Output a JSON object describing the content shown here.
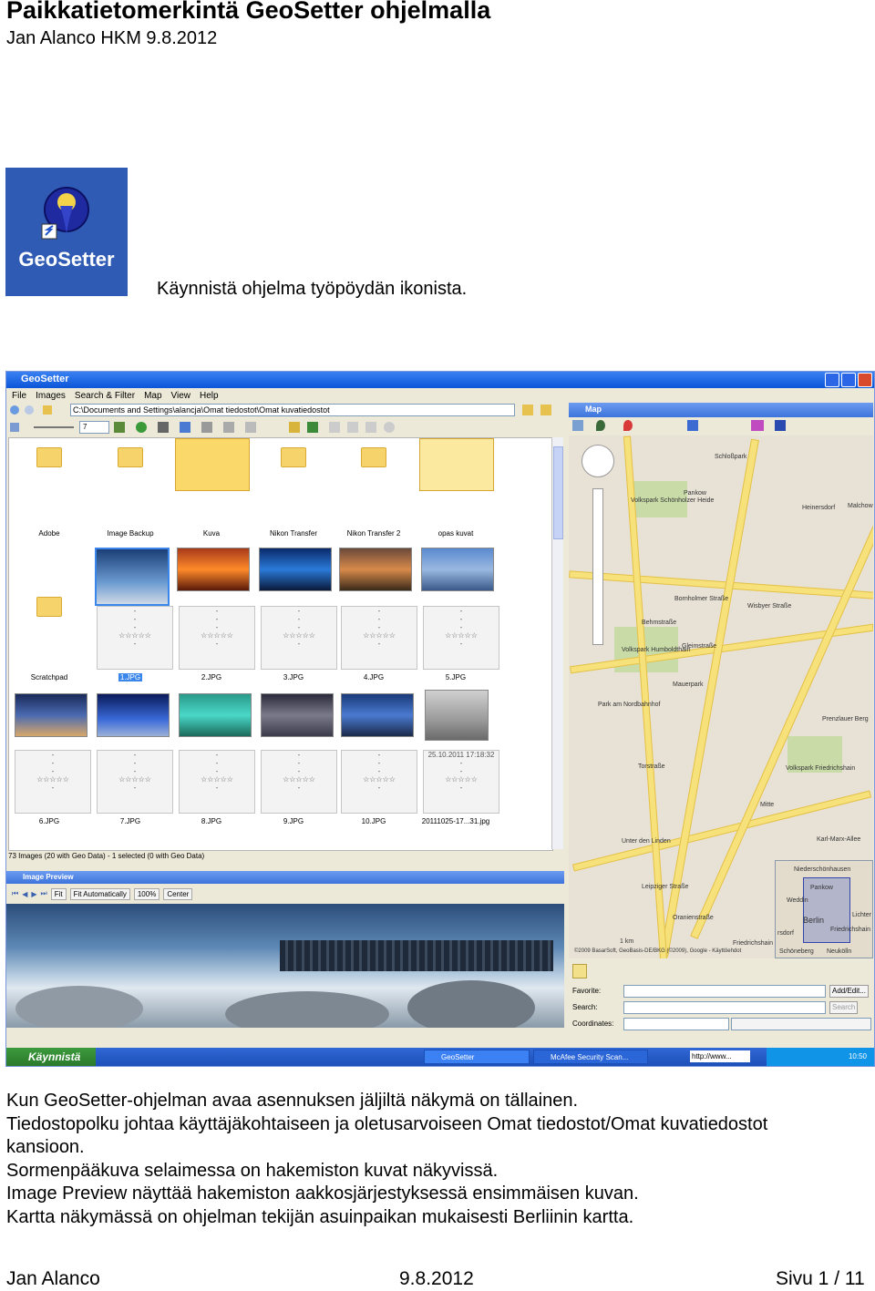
{
  "header": {
    "title": "Paikkatietomerkintä GeoSetter ohjelmalla",
    "subtitle": "Jan Alanco HKM 9.8.2012"
  },
  "desktop_icon": {
    "label": "GeoSetter",
    "icon": "geosetter-app-icon"
  },
  "caption_start": "Käynnistä ohjelma työpöydän ikonista.",
  "screenshot": {
    "window_title": "GeoSetter",
    "menu": [
      "File",
      "Images",
      "Search & Filter",
      "Map",
      "View",
      "Help"
    ],
    "path": "C:\\Documents and Settings\\alancja\\Omat tiedostot\\Omat kuvatiedostot",
    "zoom_value": "7",
    "folders": [
      "Adobe",
      "Image Backup",
      "Kuva",
      "Nikon Transfer",
      "Nikon Transfer 2",
      "opas kuvat"
    ],
    "row2_labels": [
      "Scratchpad",
      "1.JPG",
      "2.JPG",
      "3.JPG",
      "4.JPG",
      "5.JPG"
    ],
    "row3_labels": [
      "6.JPG",
      "7.JPG",
      "8.JPG",
      "9.JPG",
      "10.JPG",
      "20111025-17...31.jpg"
    ],
    "photo_timestamp": "25.10.2011 17:18:32",
    "dash": "-",
    "stars": "☆☆☆☆☆",
    "status": "73 Images (20 with Geo Data) - 1 selected (0 with Geo Data)",
    "preview_title": "Image Preview",
    "preview_tools": [
      "Fit",
      "Fit Automatically",
      "100%",
      "Center"
    ],
    "map_title": "Map",
    "map_labels": [
      "Schloßpark",
      "Pankow",
      "Heinersdorf",
      "Malchow",
      "Volkspark Schönholzer Heide",
      "Bornholmer Straße",
      "Wisbyer Straße",
      "Behmstraße",
      "Volkspark Humboldthain",
      "Gleimstraße",
      "Mauerpark",
      "Park am Nordbahnhof",
      "Prenzlauer Berg",
      "Volkspark Friedrichshain",
      "Torstraße",
      "Mitte",
      "Unter den Linden",
      "Leipziger Straße",
      "Karl-Marx-Allee",
      "Oranienstraße",
      "Friedrichshain"
    ],
    "map_scale": "1 km",
    "map_copyright": "©2009 BasarSoft, GeoBasis-DE/BKG (©2009), Google - Käyttöehdot",
    "inset_labels": [
      "Niederschönhausen",
      "Pankow",
      "Weddin",
      "Berlin",
      "Lichter",
      "Friedrichshain",
      "Schöneberg",
      "Neukölln",
      "rsdorf"
    ],
    "favorite_label": "Favorite:",
    "search_label": "Search:",
    "coordinates_label": "Coordinates:",
    "add_edit_btn": "Add/Edit...",
    "search_btn": "Search",
    "taskbar": {
      "start": "Käynnistä",
      "task1": "GeoSetter",
      "task2": "McAfee Security Scan...",
      "address": "http://www...",
      "clock": "10:50"
    }
  },
  "body_lines": [
    "Kun GeoSetter-ohjelman avaa asennuksen jäljiltä näkymä on tällainen.",
    "Tiedostopolku johtaa käyttäjäkohtaiseen ja oletusarvoiseen Omat tiedostot/Omat kuvatiedostot",
    "kansioon.",
    "Sormenpääkuva selaimessa on hakemiston kuvat näkyvissä.",
    "Image Preview näyttää hakemiston aakkosjärjestyksessä ensimmäisen kuvan.",
    "Kartta näkymässä on ohjelman tekijän asuinpaikan mukaisesti Berliinin kartta."
  ],
  "footer": {
    "author": "Jan Alanco",
    "date": "9.8.2012",
    "page": "Sivu 1 / 11"
  }
}
